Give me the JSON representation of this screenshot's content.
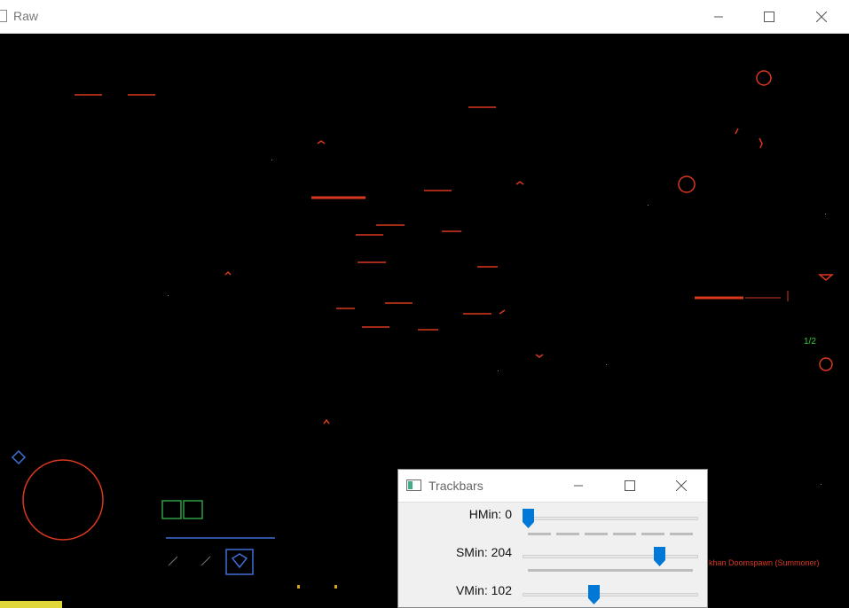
{
  "raw_window": {
    "title": "Raw",
    "controls": {
      "minimize": "minimize-icon",
      "maximize": "maximize-icon",
      "close": "close-icon"
    },
    "canvas": {
      "background": "#000000",
      "edge_color": "#d9381e",
      "overlay_texts": [
        {
          "name": "counter-text",
          "text": "1/2",
          "color": "#33cc33"
        },
        {
          "name": "unit-name-text",
          "text": "khan Doomspawn (Summoner)",
          "color": "#d9381e"
        }
      ]
    }
  },
  "trackbars_window": {
    "title": "Trackbars",
    "controls": {
      "minimize": "minimize-icon",
      "maximize": "maximize-icon",
      "close": "close-icon"
    },
    "sliders": [
      {
        "label": "HMin: 0",
        "value": 0,
        "max": 255,
        "fraction": 0.0
      },
      {
        "label": "SMin: 204",
        "value": 204,
        "max": 255,
        "fraction": 0.8
      },
      {
        "label": "VMin: 102",
        "value": 102,
        "max": 255,
        "fraction": 0.4
      }
    ],
    "accent": "#0078d7"
  }
}
